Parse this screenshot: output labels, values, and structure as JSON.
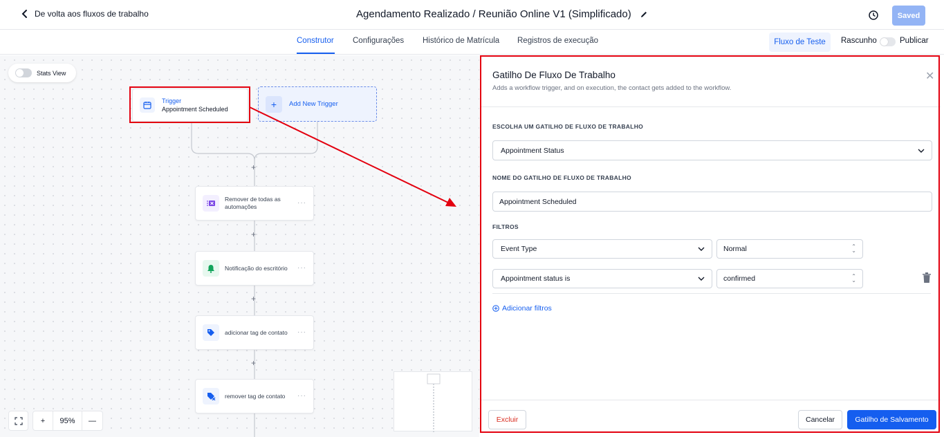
{
  "header": {
    "back_label": "De volta aos fluxos de trabalho",
    "title": "Agendamento Realizado / Reunião Online V1 (Simplificado)",
    "saved_label": "Saved"
  },
  "tabs": {
    "items": [
      {
        "label": "Construtor"
      },
      {
        "label": "Configurações"
      },
      {
        "label": "Histórico de Matrícula"
      },
      {
        "label": "Registros de execução"
      }
    ],
    "test_label": "Fluxo de Teste",
    "draft_label": "Rascunho",
    "publish_label": "Publicar"
  },
  "canvas": {
    "stats_label": "Stats View",
    "trigger": {
      "type_label": "Trigger",
      "name": "Appointment Scheduled"
    },
    "add_trigger_label": "Add New Trigger",
    "actions": [
      {
        "label": "Remover de todas as automações"
      },
      {
        "label": "Notificação do escritório"
      },
      {
        "label": "adicionar tag de contato"
      },
      {
        "label": "remover tag de contato"
      }
    ],
    "zoom_level": "95%"
  },
  "panel": {
    "title": "Gatilho De Fluxo De Trabalho",
    "subtitle": "Adds a workflow trigger, and on execution, the contact gets added to the workflow.",
    "choose_label": "ESCOLHA UM GATILHO DE FLUXO DE TRABALHO",
    "choose_value": "Appointment Status",
    "name_label": "NOME DO GATILHO DE FLUXO DE TRABALHO",
    "name_value": "Appointment Scheduled",
    "filters_label": "FILTROS",
    "filters": [
      {
        "field": "Event Type",
        "value": "Normal"
      },
      {
        "field": "Appointment status is",
        "value": "confirmed"
      }
    ],
    "add_filter_label": "Adicionar filtros",
    "delete_label": "Excluir",
    "cancel_label": "Cancelar",
    "save_label": "Gatilho de Salvamento"
  },
  "colors": {
    "accent": "#155eef",
    "highlight": "#e3000f"
  }
}
